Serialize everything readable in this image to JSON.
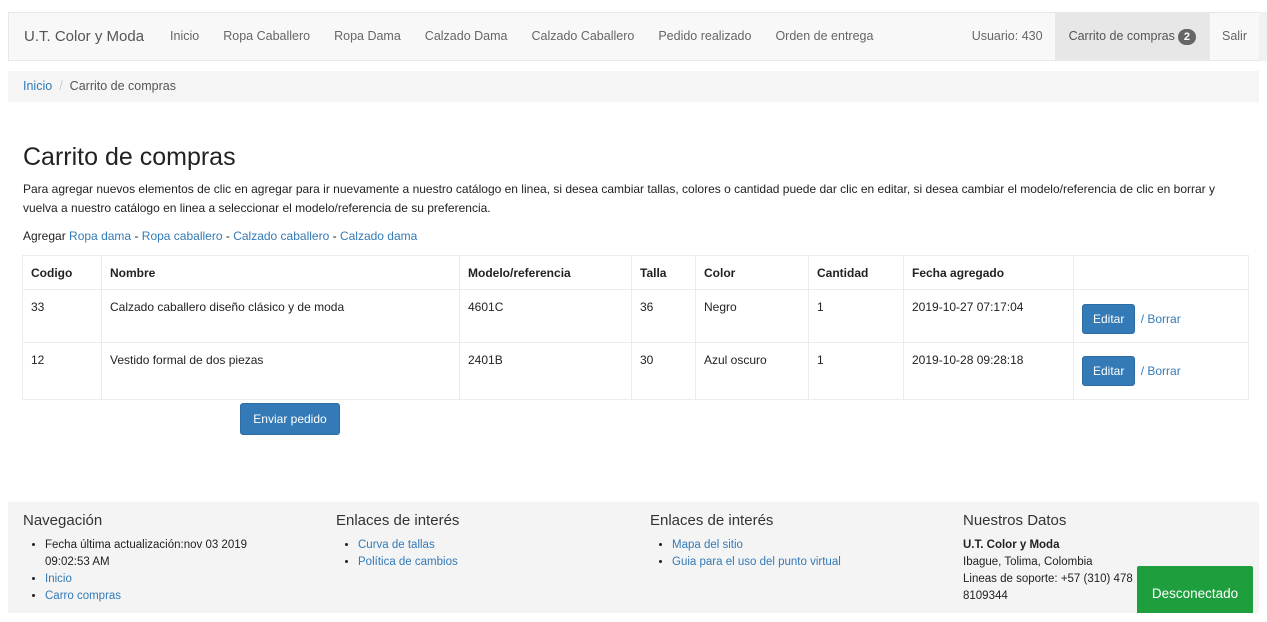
{
  "navbar": {
    "brand": "U.T. Color y Moda",
    "items": [
      "Inicio",
      "Ropa Caballero",
      "Ropa Dama",
      "Calzado Dama",
      "Calzado Caballero",
      "Pedido realizado",
      "Orden de entrega"
    ],
    "user": "Usuario: 430",
    "cart_label": "Carrito de compras",
    "cart_count": "2",
    "logout": "Salir"
  },
  "breadcrumb": {
    "home": "Inicio",
    "current": "Carrito de compras"
  },
  "main": {
    "title": "Carrito de compras",
    "intro": "Para agregar nuevos elementos de clic en agregar para ir nuevamente a nuestro catálogo en linea, si desea cambiar tallas, colores o cantidad puede dar clic en editar, si desea cambiar el modelo/referencia de clic en borrar y vuelva a nuestro catálogo en linea a seleccionar el modelo/referencia de su preferencia.",
    "add_label": "Agregar",
    "add_links": [
      "Ropa dama",
      "Ropa caballero",
      "Calzado caballero",
      "Calzado dama"
    ],
    "add_sep": "-",
    "send_button": "Enviar pedido"
  },
  "table": {
    "headers": [
      "Codigo",
      "Nombre",
      "Modelo/referencia",
      "Talla",
      "Color",
      "Cantidad",
      "Fecha agregado",
      ""
    ],
    "rows": [
      {
        "codigo": "33",
        "nombre": "Calzado caballero diseño clásico y de moda",
        "modelo": "4601C",
        "talla": "36",
        "color": "Negro",
        "cantidad": "1",
        "fecha": "2019-10-27 07:17:04",
        "edit": "Editar",
        "delete": "/ Borrar"
      },
      {
        "codigo": "12",
        "nombre": "Vestido formal de dos piezas",
        "modelo": "2401B",
        "talla": "30",
        "color": "Azul oscuro",
        "cantidad": "1",
        "fecha": "2019-10-28 09:28:18",
        "edit": "Editar",
        "delete": "/ Borrar"
      }
    ]
  },
  "footer": {
    "nav_title": "Navegación",
    "nav_items": [
      "Fecha última actualización:nov 03 2019 09:02:53 AM",
      "Inicio",
      "Carro compras"
    ],
    "links1_title": "Enlaces de interés",
    "links1": [
      "Curva de tallas",
      "Política de cambios"
    ],
    "links2_title": "Enlaces de interés",
    "links2": [
      "Mapa del sitio",
      "Guia para el uso del punto virtual"
    ],
    "datos_title": "Nuestros Datos",
    "company": "U.T. Color y Moda",
    "location": "Ibague, Tolima, Colombia",
    "support": "Lineas de soporte: +57 (310) 478",
    "support2": "8109344"
  },
  "status": {
    "label": "Desconectado",
    "color": "#1f9e3d"
  },
  "colors": {
    "link": "#337ab7",
    "primary_button": "#337ab7"
  }
}
